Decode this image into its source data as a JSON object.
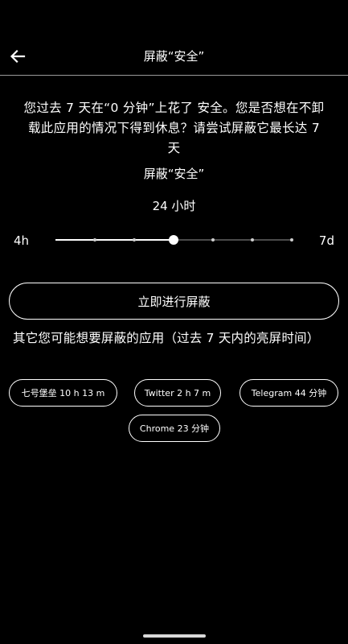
{
  "header": {
    "title": "屏蔽“安全”",
    "back_icon": "arrow-left-icon"
  },
  "description": "您过去 7 天在“0 分钟”上花了 安全。您是否想在不卸载此应用的情况下得到休息？请尝试屏蔽它最长达 7 天",
  "selected_app": {
    "name": "屏蔽“安全”",
    "duration": "24 小时"
  },
  "slider": {
    "min_label": "4h",
    "max_label": "7d",
    "steps": 7,
    "selected_index": 3
  },
  "primary_button": {
    "label": "立即进行屏蔽"
  },
  "other_apps": {
    "label": "其它您可能想要屏蔽的应用（过去 7 天内的亮屏时间）",
    "chips": [
      {
        "label": "七号堡垒 10 h 13 m"
      },
      {
        "label": "Twitter 2 h 7 m"
      },
      {
        "label": "Telegram 44 分钟"
      },
      {
        "label": "Chrome 23 分钟"
      }
    ]
  },
  "colors": {
    "background": "#000000",
    "foreground": "#ffffff",
    "divider": "#9a9a9a"
  }
}
